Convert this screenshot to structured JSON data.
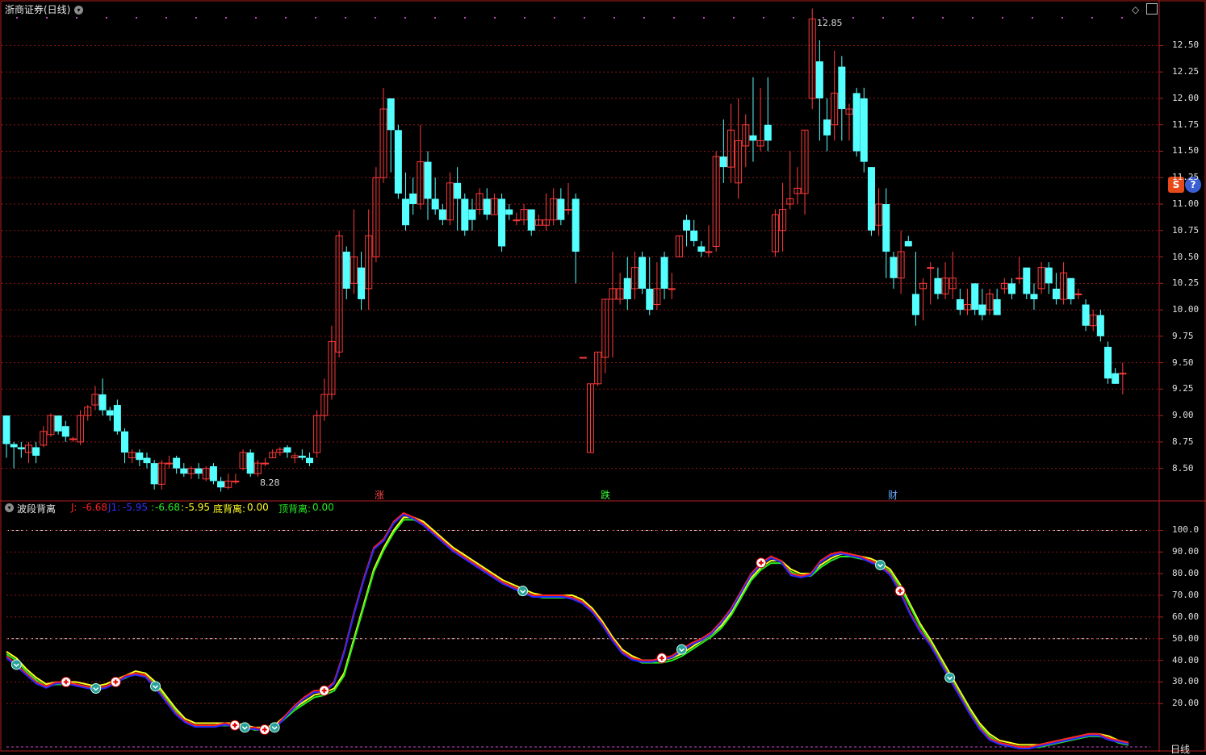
{
  "window": {
    "title": "浙商证券(日线)",
    "indicator_title": "波段背离",
    "footer_label": "日线"
  },
  "toolbar": {
    "s_button": "S",
    "help_button": "?"
  },
  "colors": {
    "up": "#ff3a3a",
    "down": "#54ffff",
    "grid": "#8a1818",
    "frame": "#b01f1f",
    "line_j": "#ff2020",
    "line_j1": "#2828ff",
    "line_k": "#22ee22",
    "line_d": "#ffff22",
    "marker_dots": "#cc44cc"
  },
  "price_axis": {
    "ticks": [
      "12.50",
      "12.25",
      "12.00",
      "11.75",
      "11.50",
      "11.25",
      "11.00",
      "10.75",
      "10.50",
      "10.25",
      "10.00",
      "9.75",
      "9.50",
      "9.25",
      "9.00",
      "8.75",
      "8.50"
    ],
    "high_label": "12.85",
    "low_label": "8.28"
  },
  "indicator_axis": {
    "ticks": [
      "100.0",
      "90.00",
      "80.00",
      "70.00",
      "60.00",
      "50.00",
      "40.00",
      "30.00",
      "20.00"
    ]
  },
  "indicator_values": {
    "j_label": "J:",
    "j_value": "-6.68",
    "j1_label": "J1:",
    "j1_value": "-5.95",
    "k_label": ":",
    "k_value": "-6.68",
    "d_label": ":",
    "d_value": "-5.95",
    "bottom_div_label": "底背离:",
    "bottom_div_value": "0.00",
    "top_div_label": "顶背离:",
    "top_div_value": "0.00"
  },
  "events": [
    {
      "label": "涨",
      "color": "#ff4444"
    },
    {
      "label": "跌",
      "color": "#33ff33"
    },
    {
      "label": "财",
      "color": "#66aaff"
    }
  ],
  "chart_data": {
    "type": "candlestick",
    "price_ylim": [
      8.2,
      12.9
    ],
    "candles": [
      [
        9.0,
        8.73,
        9.0,
        8.6
      ],
      [
        8.73,
        8.7,
        8.75,
        8.5
      ],
      [
        8.7,
        8.68,
        8.75,
        8.6
      ],
      [
        8.65,
        8.72,
        8.75,
        8.55
      ],
      [
        8.7,
        8.62,
        8.75,
        8.55
      ],
      [
        8.72,
        8.85,
        8.9,
        8.7
      ],
      [
        8.82,
        9.0,
        9.02,
        8.8
      ],
      [
        9.0,
        8.85,
        9.0,
        8.82
      ],
      [
        8.9,
        8.8,
        8.95,
        8.75
      ],
      [
        8.78,
        8.78,
        8.8,
        8.75
      ],
      [
        8.75,
        9.0,
        9.05,
        8.72
      ],
      [
        9.0,
        9.08,
        9.1,
        8.95
      ],
      [
        9.1,
        9.2,
        9.28,
        9.05
      ],
      [
        9.2,
        9.05,
        9.35,
        9.0
      ],
      [
        9.05,
        9.0,
        9.08,
        8.95
      ],
      [
        9.1,
        8.85,
        9.15,
        8.82
      ],
      [
        8.85,
        8.65,
        8.88,
        8.55
      ],
      [
        8.6,
        8.65,
        8.68,
        8.55
      ],
      [
        8.65,
        8.58,
        8.68,
        8.52
      ],
      [
        8.6,
        8.55,
        8.65,
        8.5
      ],
      [
        8.55,
        8.35,
        8.58,
        8.3
      ],
      [
        8.35,
        8.55,
        8.58,
        8.3
      ],
      [
        8.55,
        8.55,
        8.62,
        8.5
      ],
      [
        8.6,
        8.5,
        8.62,
        8.45
      ],
      [
        8.5,
        8.45,
        8.55,
        8.42
      ],
      [
        8.45,
        8.5,
        8.52,
        8.4
      ],
      [
        8.5,
        8.45,
        8.55,
        8.4
      ],
      [
        8.4,
        8.5,
        8.52,
        8.38
      ],
      [
        8.52,
        8.38,
        8.55,
        8.35
      ],
      [
        8.38,
        8.32,
        8.42,
        8.28
      ],
      [
        8.32,
        8.38,
        8.45,
        8.3
      ],
      [
        8.38,
        8.38,
        8.45,
        8.35
      ],
      [
        8.5,
        8.65,
        8.68,
        8.48
      ],
      [
        8.65,
        8.45,
        8.68,
        8.42
      ],
      [
        8.45,
        8.55,
        8.58,
        8.42
      ],
      [
        8.55,
        8.55,
        8.6,
        8.52
      ],
      [
        8.6,
        8.65,
        8.68,
        8.6
      ],
      [
        8.65,
        8.68,
        8.7,
        8.62
      ],
      [
        8.7,
        8.65,
        8.72,
        8.6
      ],
      [
        8.6,
        8.62,
        8.65,
        8.55
      ],
      [
        8.62,
        8.6,
        8.68,
        8.58
      ],
      [
        8.6,
        8.55,
        8.65,
        8.52
      ],
      [
        8.65,
        9.0,
        9.05,
        8.6
      ],
      [
        9.0,
        9.2,
        9.35,
        8.95
      ],
      [
        9.2,
        9.7,
        9.85,
        9.15
      ],
      [
        9.6,
        10.7,
        10.75,
        9.55
      ],
      [
        10.55,
        10.2,
        10.6,
        10.1
      ],
      [
        10.25,
        10.5,
        10.95,
        10.15
      ],
      [
        10.4,
        10.1,
        10.55,
        10.0
      ],
      [
        10.2,
        10.7,
        10.95,
        10.0
      ],
      [
        10.5,
        11.25,
        11.35,
        10.45
      ],
      [
        11.25,
        11.9,
        12.1,
        11.2
      ],
      [
        12.0,
        11.7,
        12.0,
        11.3
      ],
      [
        11.7,
        11.1,
        11.75,
        11.05
      ],
      [
        11.05,
        10.8,
        11.3,
        10.75
      ],
      [
        11.1,
        11.0,
        11.25,
        10.9
      ],
      [
        11.0,
        11.4,
        11.75,
        10.95
      ],
      [
        11.4,
        11.05,
        11.5,
        10.85
      ],
      [
        11.05,
        10.95,
        11.25,
        10.9
      ],
      [
        10.95,
        10.85,
        11.0,
        10.8
      ],
      [
        10.85,
        11.2,
        11.3,
        10.8
      ],
      [
        11.2,
        11.05,
        11.35,
        10.75
      ],
      [
        11.05,
        10.75,
        11.1,
        10.7
      ],
      [
        10.95,
        10.85,
        11.05,
        10.75
      ],
      [
        10.95,
        11.1,
        11.15,
        10.9
      ],
      [
        11.05,
        10.9,
        11.15,
        10.85
      ],
      [
        10.9,
        11.05,
        11.1,
        10.9
      ],
      [
        11.05,
        10.6,
        11.1,
        10.55
      ],
      [
        10.95,
        10.9,
        11.0,
        10.85
      ],
      [
        10.85,
        10.85,
        10.92,
        10.8
      ],
      [
        10.85,
        10.95,
        11.0,
        10.8
      ],
      [
        10.95,
        10.75,
        10.95,
        10.7
      ],
      [
        10.8,
        10.85,
        10.9,
        10.8
      ],
      [
        10.8,
        10.85,
        11.1,
        10.75
      ],
      [
        10.85,
        11.05,
        11.15,
        10.8
      ],
      [
        11.05,
        10.85,
        11.15,
        10.8
      ],
      [
        10.95,
        10.95,
        11.2,
        10.9
      ],
      [
        11.05,
        10.55,
        11.1,
        10.25
      ],
      [
        9.55,
        9.55,
        9.55,
        9.55
      ],
      [
        8.65,
        9.3,
        9.3,
        8.65
      ],
      [
        9.3,
        9.6,
        9.6,
        9.28
      ],
      [
        9.55,
        10.1,
        10.1,
        9.4
      ],
      [
        10.1,
        10.2,
        10.55,
        9.55
      ],
      [
        10.1,
        10.2,
        10.35,
        10.05
      ],
      [
        10.3,
        10.1,
        10.5,
        10.0
      ],
      [
        10.2,
        10.4,
        10.55,
        10.1
      ],
      [
        10.5,
        10.2,
        10.55,
        10.15
      ],
      [
        10.2,
        10.0,
        10.5,
        9.95
      ],
      [
        10.05,
        10.2,
        10.45,
        10.0
      ],
      [
        10.5,
        10.2,
        10.55,
        10.1
      ],
      [
        10.2,
        10.2,
        10.35,
        10.1
      ],
      [
        10.5,
        10.7,
        10.7,
        10.5
      ],
      [
        10.85,
        10.75,
        10.9,
        10.6
      ],
      [
        10.75,
        10.65,
        10.85,
        10.6
      ],
      [
        10.6,
        10.55,
        10.65,
        10.5
      ],
      [
        10.55,
        10.55,
        10.8,
        10.5
      ],
      [
        10.6,
        11.45,
        11.5,
        10.55
      ],
      [
        11.45,
        11.35,
        11.8,
        11.2
      ],
      [
        11.35,
        11.7,
        11.95,
        11.2
      ],
      [
        11.2,
        11.6,
        12.0,
        11.05
      ],
      [
        11.55,
        11.75,
        11.85,
        11.35
      ],
      [
        11.65,
        11.6,
        12.2,
        11.4
      ],
      [
        11.55,
        11.6,
        12.1,
        11.5
      ],
      [
        11.75,
        11.6,
        12.2,
        11.5
      ],
      [
        10.55,
        10.9,
        10.95,
        10.5
      ],
      [
        10.75,
        10.95,
        11.2,
        10.55
      ],
      [
        11.0,
        11.05,
        11.5,
        10.95
      ],
      [
        11.1,
        11.15,
        11.35,
        11.0
      ],
      [
        11.1,
        11.7,
        11.7,
        10.9
      ],
      [
        12.0,
        12.75,
        12.85,
        11.9
      ],
      [
        12.35,
        12.0,
        12.55,
        11.6
      ],
      [
        11.8,
        11.65,
        12.0,
        11.5
      ],
      [
        11.75,
        12.05,
        12.45,
        11.6
      ],
      [
        12.3,
        11.9,
        12.4,
        11.6
      ],
      [
        11.85,
        11.9,
        11.95,
        11.6
      ],
      [
        12.05,
        11.5,
        12.1,
        11.45
      ],
      [
        12.0,
        11.4,
        12.1,
        11.3
      ],
      [
        11.35,
        10.75,
        11.35,
        10.7
      ],
      [
        10.8,
        11.0,
        11.15,
        10.7
      ],
      [
        11.0,
        10.55,
        11.15,
        10.3
      ],
      [
        10.5,
        10.3,
        10.55,
        10.2
      ],
      [
        10.3,
        10.55,
        10.75,
        10.15
      ],
      [
        10.65,
        10.6,
        10.7,
        10.6
      ],
      [
        10.15,
        9.95,
        10.55,
        9.85
      ],
      [
        10.2,
        10.25,
        10.3,
        9.9
      ],
      [
        10.4,
        10.4,
        10.45,
        10.05
      ],
      [
        10.3,
        10.15,
        10.4,
        10.1
      ],
      [
        10.15,
        10.3,
        10.45,
        10.1
      ],
      [
        10.2,
        10.3,
        10.55,
        10.1
      ],
      [
        10.1,
        10.0,
        10.2,
        9.95
      ],
      [
        10.0,
        10.05,
        10.2,
        9.95
      ],
      [
        10.25,
        10.0,
        10.25,
        9.95
      ],
      [
        10.05,
        9.95,
        10.2,
        9.9
      ],
      [
        10.0,
        10.15,
        10.2,
        9.95
      ],
      [
        10.1,
        9.95,
        10.2,
        9.95
      ],
      [
        10.2,
        10.25,
        10.3,
        10.15
      ],
      [
        10.25,
        10.15,
        10.3,
        10.1
      ],
      [
        10.3,
        10.3,
        10.5,
        10.25
      ],
      [
        10.4,
        10.15,
        10.4,
        10.1
      ],
      [
        10.15,
        10.1,
        10.25,
        10.0
      ],
      [
        10.2,
        10.4,
        10.45,
        10.15
      ],
      [
        10.4,
        10.25,
        10.45,
        10.15
      ],
      [
        10.2,
        10.1,
        10.35,
        10.05
      ],
      [
        10.1,
        10.35,
        10.45,
        10.05
      ],
      [
        10.3,
        10.1,
        10.3,
        10.05
      ],
      [
        10.15,
        10.15,
        10.2,
        10.1
      ],
      [
        10.05,
        9.85,
        10.1,
        9.8
      ],
      [
        9.85,
        9.95,
        10.0,
        9.8
      ],
      [
        9.95,
        9.75,
        10.0,
        9.7
      ],
      [
        9.65,
        9.35,
        9.7,
        9.3
      ],
      [
        9.4,
        9.3,
        9.45,
        9.3
      ],
      [
        9.4,
        9.4,
        9.5,
        9.2
      ]
    ],
    "indicator_ylim": [
      0,
      108
    ],
    "j_line": [
      42,
      38,
      34,
      30,
      28,
      30,
      30,
      29,
      28,
      27,
      28,
      30,
      33,
      34,
      33,
      28,
      22,
      16,
      12,
      10,
      10,
      10,
      11,
      10,
      9,
      9,
      8,
      9,
      14,
      19,
      23,
      26,
      26,
      30,
      44,
      62,
      78,
      92,
      96,
      104,
      108,
      106,
      103,
      99,
      95,
      91,
      88,
      85,
      82,
      79,
      76,
      74,
      72,
      70,
      70,
      70,
      70,
      69,
      67,
      63,
      57,
      50,
      44,
      41,
      40,
      40,
      41,
      42,
      45,
      48,
      50,
      53,
      58,
      64,
      72,
      80,
      85,
      88,
      86,
      80,
      79,
      80,
      86,
      89,
      90,
      89,
      88,
      86,
      84,
      80,
      72,
      62,
      54,
      48,
      40,
      32,
      24,
      16,
      9,
      4,
      2,
      1,
      0,
      0,
      1,
      2,
      3,
      4,
      5,
      6,
      6,
      4,
      3,
      2
    ],
    "d_line": [
      44,
      41,
      36,
      32,
      29,
      30,
      30,
      30,
      29,
      28,
      29,
      31,
      33,
      35,
      34,
      30,
      24,
      18,
      13,
      11,
      11,
      11,
      11,
      11,
      10,
      9,
      9,
      10,
      14,
      18,
      21,
      24,
      25,
      27,
      34,
      50,
      66,
      82,
      92,
      100,
      106,
      106,
      104,
      100,
      96,
      92,
      89,
      86,
      83,
      80,
      77,
      75,
      73,
      71,
      70,
      70,
      70,
      70,
      68,
      64,
      58,
      51,
      45,
      42,
      40,
      40,
      40,
      41,
      43,
      46,
      49,
      52,
      56,
      62,
      70,
      78,
      83,
      86,
      86,
      82,
      80,
      80,
      84,
      87,
      89,
      89,
      88,
      87,
      85,
      82,
      75,
      66,
      57,
      50,
      42,
      34,
      26,
      18,
      11,
      6,
      3,
      2,
      1,
      1,
      1,
      2,
      3,
      4,
      5,
      6,
      6,
      5,
      3,
      2
    ]
  }
}
